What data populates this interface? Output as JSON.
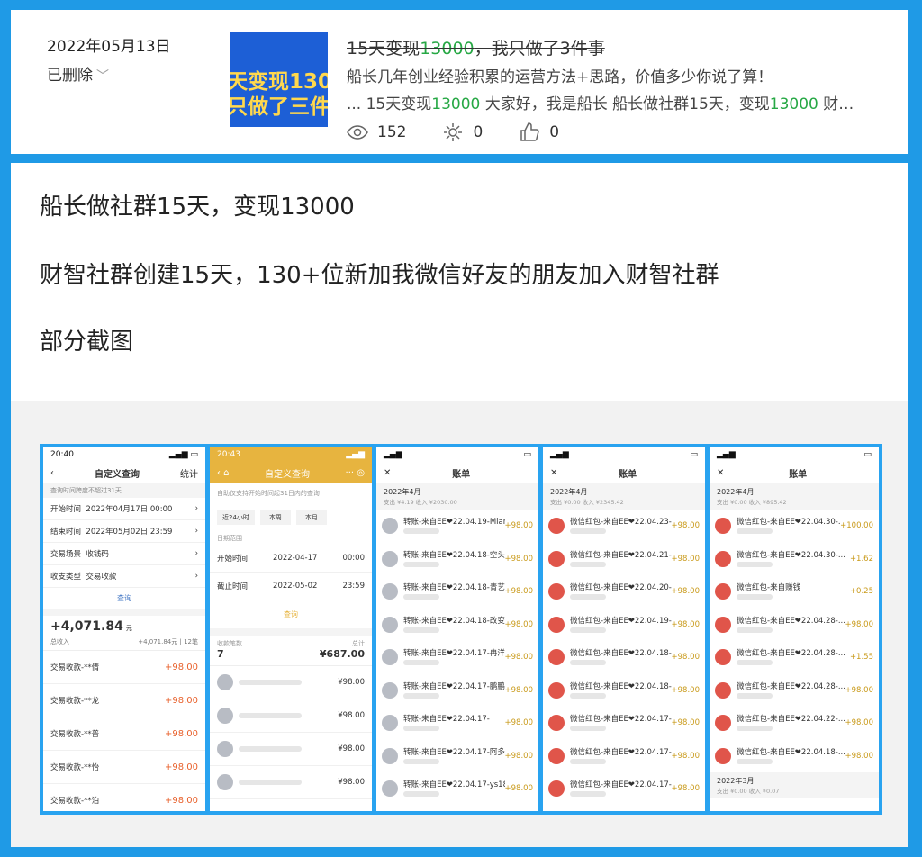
{
  "header": {
    "date": "2022年05月13日",
    "status": "已删除",
    "thumb_lines": [
      "天变现130",
      "只做了三件"
    ],
    "title_pre": "15天变现",
    "title_num": "13000",
    "title_post": "，我只做了3件事",
    "subtitle": "船长几年创业经验积累的运营方法+思路，价值多少你说了算！",
    "excerpt": {
      "p1": "... 15天变现",
      "n1": "13000",
      "p2": " 大家好，我是船长 船长做社群15天，变现",
      "n2": "13000",
      "p3": " 财…"
    },
    "stats": {
      "views": "152",
      "shares": "0",
      "likes": "0"
    }
  },
  "body": {
    "paragraphs": [
      "船长做社群15天，变现13000",
      "财智社群创建15天，130+位新加我微信好友的朋友加入财智社群",
      "部分截图"
    ]
  },
  "screens": {
    "s1": {
      "time": "20:40",
      "title": "自定义查询",
      "right": "统计",
      "hint": "查询时间跨度不超过31天",
      "fields": [
        {
          "label": "开始时间",
          "value": "2022年04月17日 00:00"
        },
        {
          "label": "结束时间",
          "value": "2022年05月02日 23:59"
        },
        {
          "label": "交易场景",
          "value": "收钱码"
        },
        {
          "label": "收支类型",
          "value": "交易收款"
        }
      ],
      "query": "查询",
      "total": "+4,071.84",
      "total_unit": "元",
      "total_label": "总收入",
      "total_small": "+4,071.84元",
      "count": "12笔",
      "rows": [
        {
          "name": "交易收款-**倩",
          "amt": "+98.00"
        },
        {
          "name": "交易收款-**龙",
          "amt": "+98.00"
        },
        {
          "name": "交易收款-**普",
          "amt": "+98.00"
        },
        {
          "name": "交易收款-**怡",
          "amt": "+98.00"
        },
        {
          "name": "交易收款-**泊",
          "amt": "+98.00"
        }
      ]
    },
    "s2": {
      "time": "20:43",
      "title": "自定义查询",
      "hint": "自助仅支持开始时间起31日内的查询",
      "chips": [
        "近24小时",
        "本周",
        "本月"
      ],
      "range_label": "日期范围",
      "start_label": "开始时间",
      "start_date": "2022-04-17",
      "start_time": "00:00",
      "end_label": "截止时间",
      "end_date": "2022-05-02",
      "end_time": "23:59",
      "query": "查询",
      "count_label": "收款笔数",
      "count": "7",
      "sum_label": "总计",
      "sum": "¥687.00",
      "items": [
        "¥98.00",
        "¥98.00",
        "¥98.00",
        "¥98.00"
      ]
    },
    "s3": {
      "title": "账单",
      "month": "2022年4月",
      "sub": "支出 ¥4.19 收入 ¥2030.00",
      "rows": [
        {
          "name": "转账-来自EE❤22.04.19-Mian...",
          "amt": "+98.00"
        },
        {
          "name": "转账-来自EE❤22.04.18-空头...",
          "amt": "+98.00"
        },
        {
          "name": "转账-来自EE❤22.04.18-青艺",
          "amt": "+98.00"
        },
        {
          "name": "转账-来自EE❤22.04.18-改变...",
          "amt": "+98.00"
        },
        {
          "name": "转账-来自EE❤22.04.17-冉洋",
          "amt": "+98.00"
        },
        {
          "name": "转账-来自EE❤22.04.17-鹏鹏...",
          "amt": "+98.00"
        },
        {
          "name": "转账-来自EE❤22.04.17-",
          "amt": "+98.00"
        },
        {
          "name": "转账-来自EE❤22.04.17-阿多",
          "amt": "+98.00"
        },
        {
          "name": "转账-来自EE❤22.04.17-ys18...",
          "amt": "+98.00"
        }
      ]
    },
    "s4": {
      "title": "账单",
      "month": "2022年4月",
      "sub": "支出 ¥0.00 收入 ¥2345.42",
      "rows": [
        {
          "name": "微信红包-来自EE❤22.04.23-文",
          "amt": "+98.00"
        },
        {
          "name": "微信红包-来自EE❤22.04.21-...",
          "amt": "+98.00"
        },
        {
          "name": "微信红包-来自EE❤22.04.20-...",
          "amt": "+98.00"
        },
        {
          "name": "微信红包-来自EE❤22.04.19-援",
          "amt": "+98.00"
        },
        {
          "name": "微信红包-来自EE❤22.04.18-...",
          "amt": "+98.00"
        },
        {
          "name": "微信红包-来自EE❤22.04.18-...",
          "amt": "+98.00"
        },
        {
          "name": "微信红包-来自EE❤22.04.17-...",
          "amt": "+98.00"
        },
        {
          "name": "微信红包-来自EE❤22.04.17-...",
          "amt": "+98.00"
        },
        {
          "name": "微信红包-来自EE❤22.04.17-...",
          "amt": "+98.00"
        }
      ]
    },
    "s5": {
      "title": "账单",
      "month": "2022年4月",
      "sub": "支出 ¥0.00 收入 ¥895.42",
      "rows": [
        {
          "name": "微信红包-来自EE❤22.04.30-...",
          "amt": "+100.00"
        },
        {
          "name": "微信红包-来自EE❤22.04.30-...",
          "amt": "+1.62"
        },
        {
          "name": "微信红包-来自赚钱",
          "amt": "+0.25"
        },
        {
          "name": "微信红包-来自EE❤22.04.28-...",
          "amt": "+98.00"
        },
        {
          "name": "微信红包-来自EE❤22.04.28-...",
          "amt": "+1.55"
        },
        {
          "name": "微信红包-来自EE❤22.04.28-...",
          "amt": "+98.00"
        },
        {
          "name": "微信红包-来自EE❤22.04.22-...",
          "amt": "+98.00"
        },
        {
          "name": "微信红包-来自EE❤22.04.18-...",
          "amt": "+98.00"
        }
      ],
      "next_month": "2022年3月",
      "next_sub": "支出 ¥0.00 收入 ¥0.07"
    }
  },
  "colors": {
    "accent_blue": "#1f9ae6",
    "green": "#27a845",
    "orange": "#e8612c",
    "wx_red": "#e0554a"
  }
}
